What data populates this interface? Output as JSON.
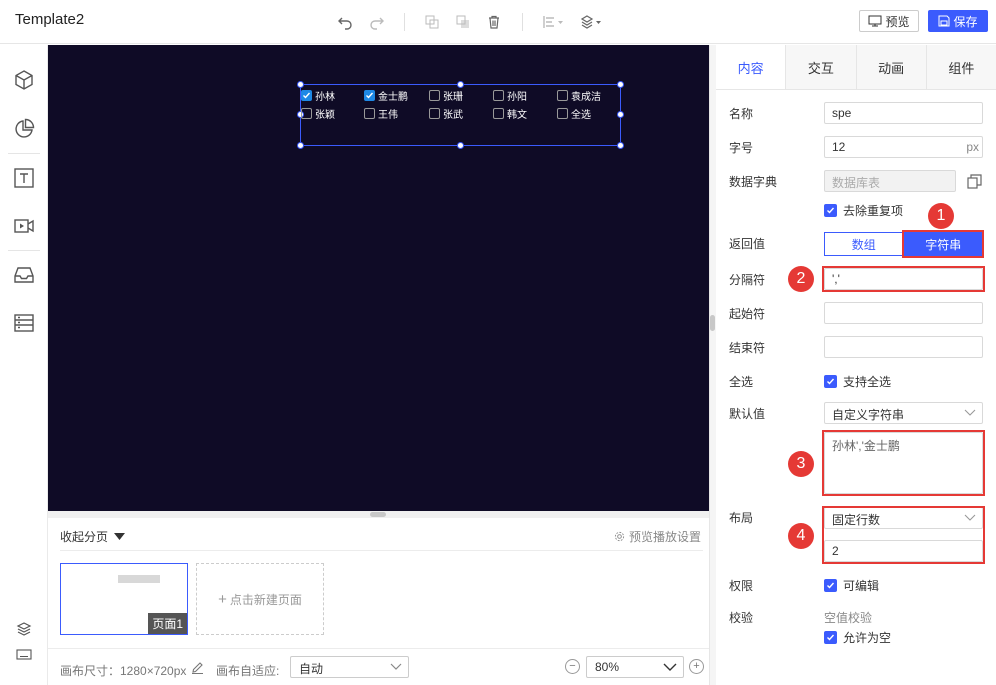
{
  "app": {
    "title": "Template2"
  },
  "toolbar": {
    "preview_label": "预览",
    "save_label": "保存",
    "icons": [
      "undo-icon",
      "redo-icon",
      "copy-icon",
      "paste-icon",
      "delete-icon",
      "align-icon",
      "layer-icon"
    ]
  },
  "left_nav": {
    "items": [
      {
        "icon": "cube-icon"
      },
      {
        "icon": "pie-chart-icon"
      },
      {
        "icon": "text-box-icon"
      },
      {
        "icon": "video-icon"
      },
      {
        "icon": "inbox-icon"
      },
      {
        "icon": "list-panel-icon"
      }
    ],
    "bottom_icons": [
      "layers-icon",
      "keyboard-icon"
    ]
  },
  "widget": {
    "options": [
      {
        "label": "孙林",
        "checked": true
      },
      {
        "label": "金士鹏",
        "checked": true
      },
      {
        "label": "张珊",
        "checked": false
      },
      {
        "label": "孙阳",
        "checked": false
      },
      {
        "label": "袁成洁",
        "checked": false
      },
      {
        "label": "张颖",
        "checked": false
      },
      {
        "label": "王伟",
        "checked": false
      },
      {
        "label": "张武",
        "checked": false
      },
      {
        "label": "韩文",
        "checked": false
      },
      {
        "label": "全选",
        "checked": false
      }
    ]
  },
  "pages": {
    "collapse_label": "收起分页",
    "preview_settings_label": "预览播放设置",
    "page_label": "页面1",
    "new_page_label": "点击新建页面"
  },
  "footer": {
    "canvas_size_label": "画布尺寸：1280×720px",
    "fit_label": "画布自适应:",
    "fit_value": "自动",
    "zoom_value": "80%"
  },
  "panel": {
    "tabs": [
      "内容",
      "交互",
      "动画",
      "组件"
    ],
    "name_label": "名称",
    "name_value": "spe",
    "font_size_label": "字号",
    "font_size_value": "12",
    "font_size_unit": "px",
    "dict_label": "数据字典",
    "dict_placeholder": "数据库表",
    "dedupe_label": "去除重复项",
    "return_label": "返回值",
    "return_options": [
      "数组",
      "字符串"
    ],
    "separator_label": "分隔符",
    "separator_value": "','",
    "start_label": "起始符",
    "end_label": "结束符",
    "select_all_label": "全选",
    "select_all_check": "支持全选",
    "default_label": "默认值",
    "default_type": "自定义字符串",
    "default_value": "孙林','金士鹏",
    "layout_label": "布局",
    "layout_type": "固定行数",
    "layout_value": "2",
    "permission_label": "权限",
    "editable_label": "可编辑",
    "validate_label": "校验",
    "empty_check_label": "空值校验",
    "allow_empty_label": "允许为空"
  },
  "annotations": [
    "1",
    "2",
    "3",
    "4"
  ],
  "colors": {
    "accent": "#3b5bfd",
    "canvas": "#0f0b26",
    "highlight": "#e53935"
  }
}
